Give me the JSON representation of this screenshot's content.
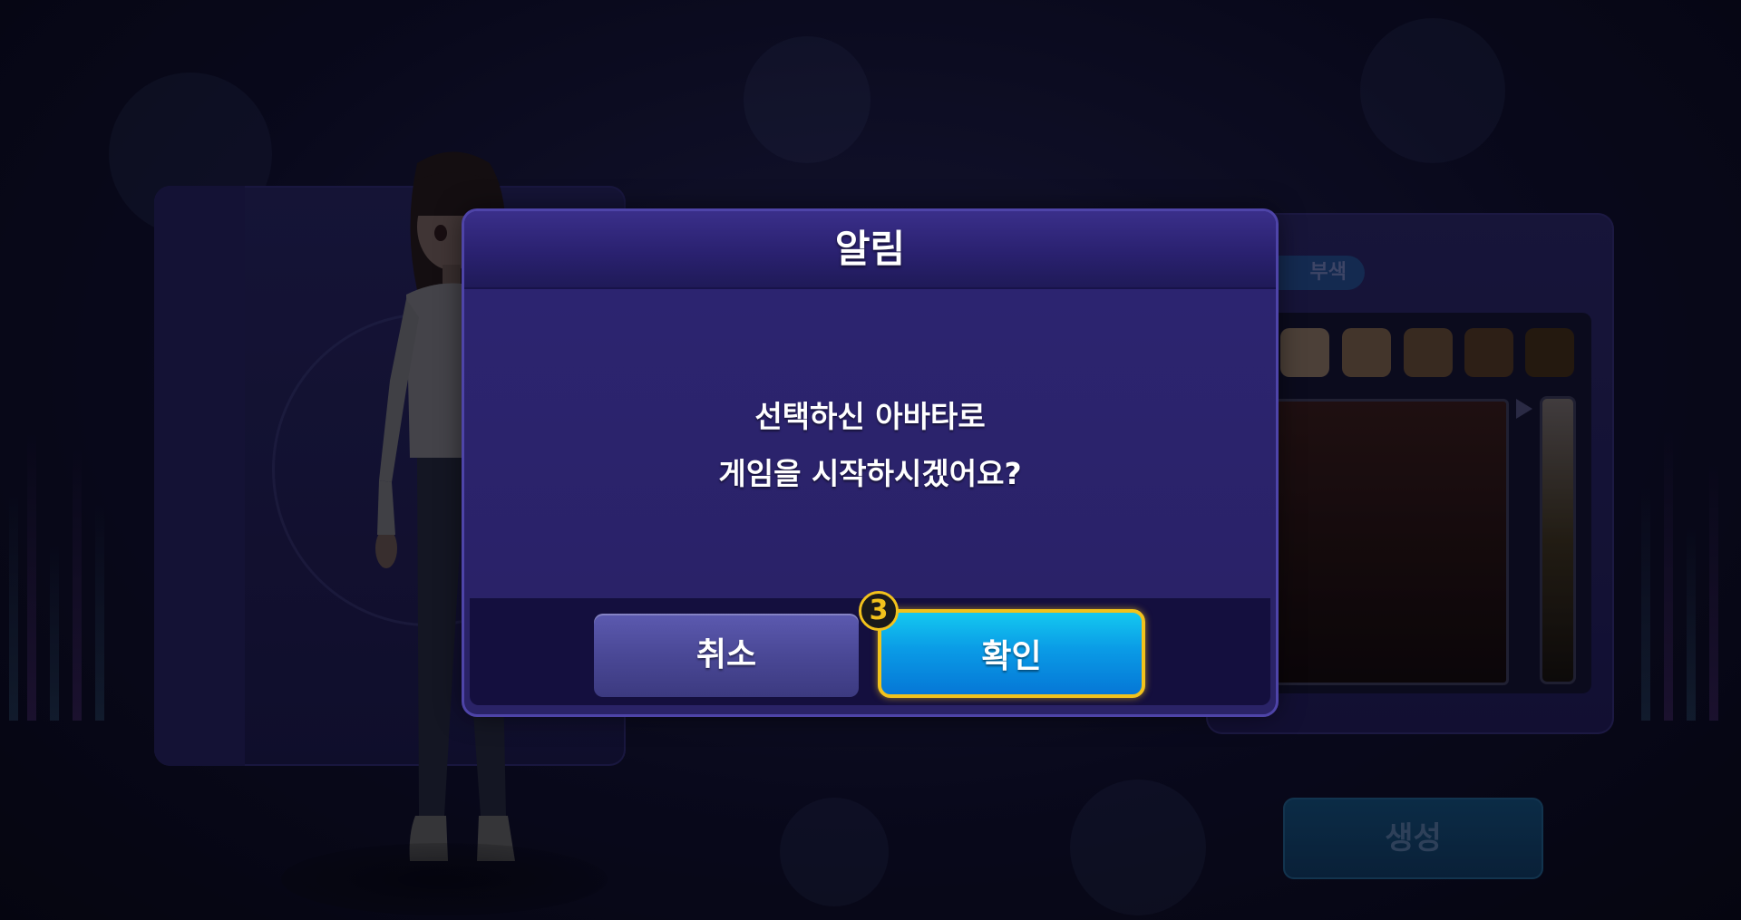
{
  "dialog": {
    "title": "알림",
    "message_line1": "선택하신 아바타로",
    "message_line2": "게임을 시작하시겠어요?",
    "cancel_label": "취소",
    "confirm_label": "확인"
  },
  "step_badge": "3",
  "background": {
    "right_panel_tag": "부색",
    "create_button_label": "생성"
  },
  "colors": {
    "accent_highlight": "#f2c21c",
    "confirm_blue": "#0a9be6",
    "cancel_purple": "#4a4896",
    "dialog_bg": "#2a2367"
  },
  "swatch_colors": [
    "#6a5a48",
    "#5e4a36",
    "#4e3a26",
    "#3e2a18",
    "#32220e"
  ]
}
